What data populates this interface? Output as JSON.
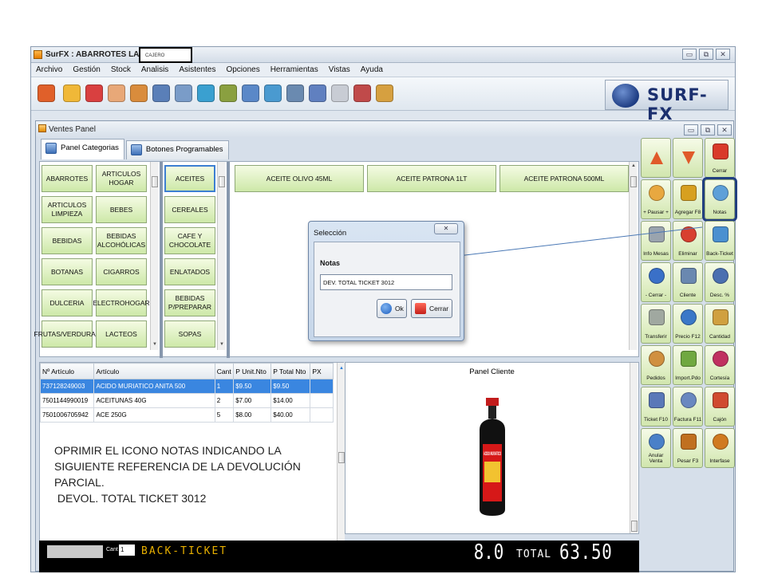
{
  "window": {
    "title": "SurFX : ABARROTES LA ALAMEDA",
    "cashier_label": "CAJERO",
    "controls": {
      "minimize": "▭",
      "maximize": "⧉",
      "close": "✕"
    }
  },
  "menu": [
    "Archivo",
    "Gestión",
    "Stock",
    "Analisis",
    "Asistentes",
    "Opciones",
    "Herramientas",
    "Vistas",
    "Ayuda"
  ],
  "toolbar": {
    "icons": [
      "power-icon",
      "edit-icon",
      "book-icon",
      "user-icon",
      "cookie-icon",
      "clipboard-icon",
      "printer-icon",
      "transfer-icon",
      "refresh-icon",
      "bottle-icon",
      "tag-icon",
      "calculator-icon",
      "calendar-icon",
      "ticket-icon",
      "tools-icon",
      "clock-icon"
    ],
    "icon_colors": [
      "#e0602a",
      "#f0b838",
      "#d94040",
      "#e8a878",
      "#d98c3c",
      "#5a7fb8",
      "#7a9cc8",
      "#3aa0d0",
      "#8aa040",
      "#5a88c8",
      "#4a9ad0",
      "#6a8ab0",
      "#6080c0",
      "#c8ccd4",
      "#c04a4a",
      "#d6a040"
    ],
    "brand": "SURF-FX"
  },
  "ventes_panel": {
    "title": "Ventes Panel",
    "tabs": [
      {
        "label": "Panel Categorias",
        "active": true
      },
      {
        "label": "Botones Programables",
        "active": false
      }
    ],
    "categories": [
      "ABARROTES",
      "ARTICULOS HOGAR",
      "ARTICULOS LIMPIEZA",
      "BEBES",
      "BEBIDAS",
      "BEBIDAS ALCOHÓLICAS",
      "BOTANAS",
      "CIGARROS",
      "DULCERIA",
      "ELECTROHOGAR",
      "FRUTAS/VERDURAS",
      "LACTEOS"
    ],
    "subcategories": [
      "ACEITES",
      "CEREALES",
      "CAFE Y CHOCOLATE",
      "ENLATADOS",
      "BEBIDAS P/PREPARAR",
      "SOPAS"
    ],
    "products": [
      "ACEITE OLIVO 45ML",
      "ACEITE PATRONA 1LT",
      "ACEITE PATRONA 500ML"
    ]
  },
  "side_buttons": [
    {
      "label": "",
      "icon": "arrow-up-icon"
    },
    {
      "label": "",
      "icon": "arrow-down-icon"
    },
    {
      "label": "Cerrar",
      "icon": "close-x-icon"
    },
    {
      "label": "+ Pausar +",
      "icon": "pause-doc-icon"
    },
    {
      "label": "Agregar F8",
      "icon": "hands-icon"
    },
    {
      "label": "Notas",
      "icon": "notes-icon"
    },
    {
      "label": "Info Mesas",
      "icon": "info-tables-icon"
    },
    {
      "label": "Eliminar",
      "icon": "delete-icon"
    },
    {
      "label": "Back-Ticket",
      "icon": "back-ticket-icon"
    },
    {
      "label": "- Cerrar -",
      "icon": "close-ring-icon"
    },
    {
      "label": "Cliente",
      "icon": "client-icon"
    },
    {
      "label": "Desc. %",
      "icon": "percent-icon"
    },
    {
      "label": "Transferir",
      "icon": "transfer-chair-icon"
    },
    {
      "label": "Precio F12",
      "icon": "price-icon"
    },
    {
      "label": "Cantidad",
      "icon": "quantity-icon"
    },
    {
      "label": "Pedidos",
      "icon": "orders-icon"
    },
    {
      "label": "Import.Pdo",
      "icon": "import-icon"
    },
    {
      "label": "Cortesía",
      "icon": "gift-icon"
    },
    {
      "label": "Ticket F10",
      "icon": "ticket-print-icon"
    },
    {
      "label": "Factura F11",
      "icon": "invoice-icon"
    },
    {
      "label": "Cajón",
      "icon": "drawer-icon"
    },
    {
      "label": "Anular Venta",
      "icon": "cancel-sale-icon"
    },
    {
      "label": "Pesar F3",
      "icon": "scale-icon"
    },
    {
      "label": "Interfase",
      "icon": "interface-icon"
    }
  ],
  "items_table": {
    "columns": [
      "Nº Artículo",
      "Artículo",
      "Cant",
      "P Unit.Nto",
      "P Total Nto",
      "PX"
    ],
    "rows": [
      {
        "code": "737128249003",
        "name": "ACIDO MURIATICO ANITA 500",
        "qty": "1",
        "unit": "$9.50",
        "total": "$9.50",
        "px": "",
        "selected": true
      },
      {
        "code": "7501144990019",
        "name": "ACEITUNAS 40G",
        "qty": "2",
        "unit": "$7.00",
        "total": "$14.00",
        "px": "",
        "selected": false
      },
      {
        "code": "7501006705942",
        "name": "ACE 250G",
        "qty": "5",
        "unit": "$8.00",
        "total": "$40.00",
        "px": "",
        "selected": false
      }
    ]
  },
  "annotation": {
    "lines": [
      "OPRIMIR EL ICONO NOTAS  INDICANDO LA",
      "SIGUIENTE REFERENCIA DE LA DEVOLUCIÓN",
      "PARCIAL.",
      " DEVOL. TOTAL TICKET 3012"
    ]
  },
  "cliente_panel": {
    "title": "Panel Cliente",
    "product_label": "ACIDO MURIATICO"
  },
  "status": {
    "cant_label": "Cant",
    "cant_value": "1",
    "mode": "BACK-TICKET",
    "qty": "8.0",
    "total_label": "TOTAL",
    "total": "63.50"
  },
  "dialog": {
    "title": "Selección",
    "close": "✕",
    "label": "Notas",
    "value": "DEV. TOTAL TICKET 3012",
    "ok": "Ok",
    "cancel": "Cerrar"
  },
  "colors": {
    "accent": "#3a86e0",
    "button_green": "#cde8a8",
    "danger": "#e05a2a",
    "focus": "#213f80"
  }
}
